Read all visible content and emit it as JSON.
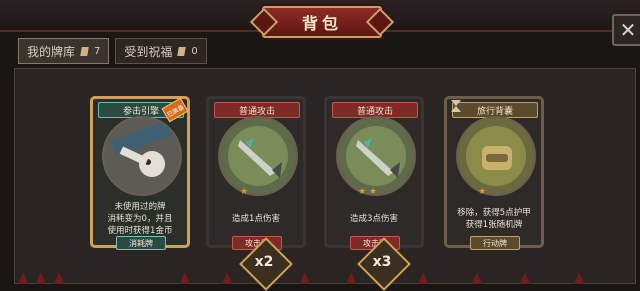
{
  "window": {
    "title": "背包",
    "close_label": "✕"
  },
  "tabs": [
    {
      "label": "我的牌库",
      "count": "7"
    },
    {
      "label": "受到祝福",
      "count": "0"
    }
  ],
  "cards": [
    {
      "name": "参击引擎",
      "tag": "已装备",
      "description": "未使用过的牌\n消耗变为0，并且\n使用时获得1金币",
      "type_label": "消耗牌",
      "stars_on": 0,
      "stars_total": 0,
      "multiplier": ""
    },
    {
      "name": "普通攻击",
      "tag": "",
      "description": "造成1点伤害",
      "type_label": "攻击牌",
      "stars_on": 1,
      "stars_total": 3,
      "multiplier": "x2"
    },
    {
      "name": "普通攻击",
      "tag": "",
      "description": "造成3点伤害",
      "type_label": "攻击牌",
      "stars_on": 2,
      "stars_total": 3,
      "multiplier": "x3"
    },
    {
      "name": "旅行背囊",
      "tag": "",
      "description": "移除，获得5点护甲\n获得1张随机牌",
      "type_label": "行动牌",
      "stars_on": 1,
      "stars_total": 3,
      "multiplier": ""
    }
  ],
  "colors": {
    "title_red": "#8e2b22",
    "panel_bg": "#2a2522",
    "card_green_header": "#2b4a43",
    "card_red_header": "#7e2b27",
    "card_gold_header": "#5b4a2c",
    "badge_border": "#d0a24e"
  }
}
